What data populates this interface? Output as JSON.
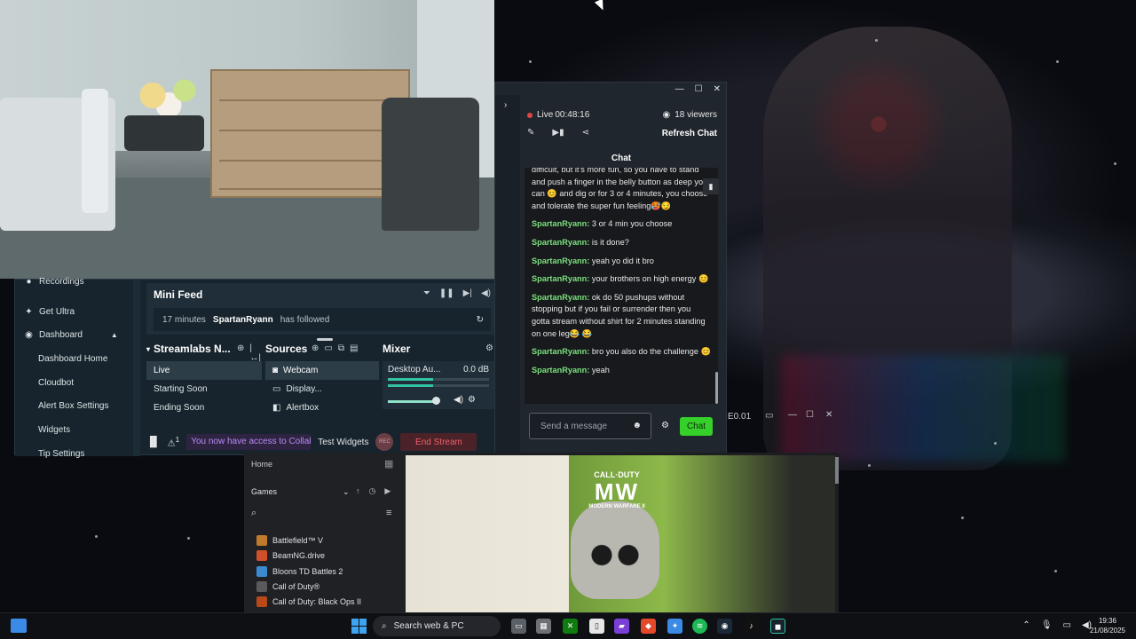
{
  "streamlabs": {
    "sidebar": {
      "recordings": "Recordings",
      "get_ultra": "Get Ultra",
      "dashboard": "Dashboard",
      "dashboard_home": "Dashboard Home",
      "cloudbot": "Cloudbot",
      "alert_box_settings": "Alert Box Settings",
      "widgets": "Widgets",
      "tip_settings": "Tip Settings"
    },
    "mini_feed": {
      "title": "Mini Feed",
      "event_time": "17 minutes",
      "event_user": "SpartanRyann",
      "event_action": "has followed"
    },
    "scenes": {
      "title": "Streamlabs N...",
      "items": [
        "Live",
        "Starting Soon",
        "Ending Soon"
      ]
    },
    "sources": {
      "title": "Sources",
      "items": [
        "Webcam",
        "Display...",
        "Alertbox"
      ]
    },
    "mixer": {
      "title": "Mixer",
      "channel": "Desktop Au...",
      "level": "0.0 dB",
      "meter_fraction": 0.45
    },
    "footer": {
      "notification_count": "1",
      "collab_note": "You now have access to Collab Cam",
      "test_widgets": "Test Widgets",
      "rec_label": "REC",
      "end_stream": "End Stream"
    }
  },
  "chat_window": {
    "live_label": "Live",
    "live_time": "00:48:16",
    "viewers": "18 viewers",
    "refresh_chat": "Refresh Chat",
    "chat_title": "Chat",
    "messages": [
      {
        "user": "",
        "text": "difficult, but it's more fun, so you have to stand and push a finger in the belly button as deep you can 😊 and dig or for 3 or 4 minutes, you choose and tolerate the super fun feeling🥵😏"
      },
      {
        "user": "SpartanRyann:",
        "text": "3 or 4 min you choose"
      },
      {
        "user": "SpartanRyann:",
        "text": "is it done?"
      },
      {
        "user": "SpartanRyann:",
        "text": "yeah yo did it bro"
      },
      {
        "user": "SpartanRyann:",
        "text": "your brothers on high energy 😊"
      },
      {
        "user": "SpartanRyann:",
        "text": "ok do 50 pushups without stopping but if you fail or surrender then you gotta stream without shirt for 2 minutes standing on one leg😂 😂"
      },
      {
        "user": "SpartanRyann:",
        "text": "bro you also do the challenge 😊"
      },
      {
        "user": "SpartanRyann:",
        "text": "yeah"
      }
    ],
    "input_placeholder": "Send a message",
    "send_label": "Chat"
  },
  "game_window": {
    "titlebar_label": "E0.01",
    "home": "Home",
    "games_label": "Games",
    "games": [
      {
        "name": "Battlefield™ V",
        "color": "#c07a2a"
      },
      {
        "name": "BeamNG.drive",
        "color": "#d0502a"
      },
      {
        "name": "Bloons TD Battles 2",
        "color": "#3a8ad0"
      },
      {
        "name": "Call of Duty®",
        "color": "#5a5a5a"
      },
      {
        "name": "Call of Duty: Black Ops II",
        "color": "#b84a1a"
      }
    ],
    "art_title_top": "CALL·DUTY",
    "art_title_main": "MW",
    "art_title_sub": "MODERN WARFARE II"
  },
  "taskbar": {
    "search_label": "Search web & PC",
    "time": "19:36",
    "date": "21/08/2025"
  }
}
